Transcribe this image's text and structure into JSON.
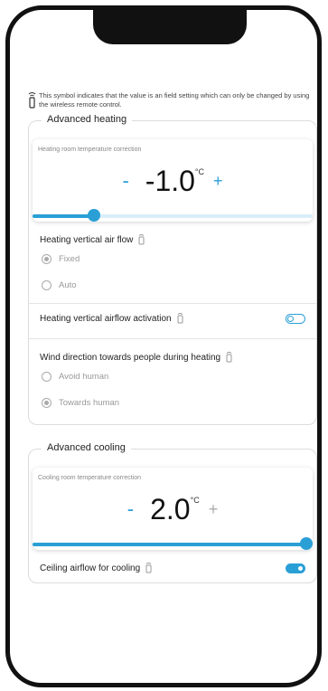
{
  "note": {
    "text": "This symbol indicates that the value is an field setting which can only be changed by using the wireless remote control."
  },
  "advanced_heating": {
    "title": "Advanced heating",
    "temp_card": {
      "label": "Heating room temperature correction",
      "minus": "-",
      "value": "-1.0",
      "unit": "°C",
      "plus": "+",
      "slider_fraction": 0.22
    },
    "vertical_air_flow": {
      "label": "Heating vertical air flow",
      "options": [
        "Fixed",
        "Auto"
      ],
      "selected": "Fixed"
    },
    "airflow_activation": {
      "label": "Heating vertical airflow activation",
      "on": false
    },
    "wind_direction": {
      "label": "Wind direction towards people during heating",
      "options": [
        "Avoid human",
        "Towards human"
      ],
      "selected": "Towards human"
    }
  },
  "advanced_cooling": {
    "title": "Advanced cooling",
    "temp_card": {
      "label": "Cooling room temperature correction",
      "minus": "-",
      "value": "2.0",
      "unit": "°C",
      "plus": "+",
      "slider_fraction": 1.0
    },
    "next_row": {
      "label": "Ceiling airflow for cooling",
      "on": true
    }
  },
  "colors": {
    "accent": "#2a9fd6",
    "muted": "#999999"
  }
}
